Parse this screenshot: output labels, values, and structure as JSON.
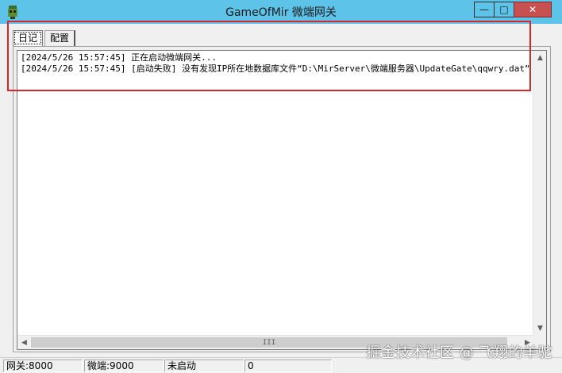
{
  "window": {
    "title": "GameOfMir 微端网关",
    "controls": {
      "minimize": "—",
      "maximize": "□",
      "close": "✕"
    }
  },
  "tabs": [
    {
      "label": "日记",
      "active": true
    },
    {
      "label": "配置",
      "active": false
    }
  ],
  "log": {
    "lines": [
      "[2024/5/26 15:57:45] 正在启动微端网关...",
      "[2024/5/26 15:57:45] [启动失败] 没有发现IP所在地数据库文件“D:\\MirServer\\微端服务器\\UpdateGate\\qqwry.dat”,"
    ]
  },
  "scrollbar": {
    "thumb_grip": "III"
  },
  "statusbar": {
    "gateway_port": "网关:8000",
    "micro_port": "微端:9000",
    "state": "未启动",
    "count": "0"
  },
  "watermark": "掘金技术社区 @ 飞翔的羊驼",
  "colors": {
    "titlebar": "#5ec3e8",
    "highlight_box": "#d9262a",
    "background": "#f0f0f0"
  },
  "icons": {
    "app": "game-app-icon",
    "scroll_up": "arrow-up-icon",
    "scroll_down": "arrow-down-icon",
    "scroll_left": "arrow-left-icon",
    "scroll_right": "arrow-right-icon"
  }
}
